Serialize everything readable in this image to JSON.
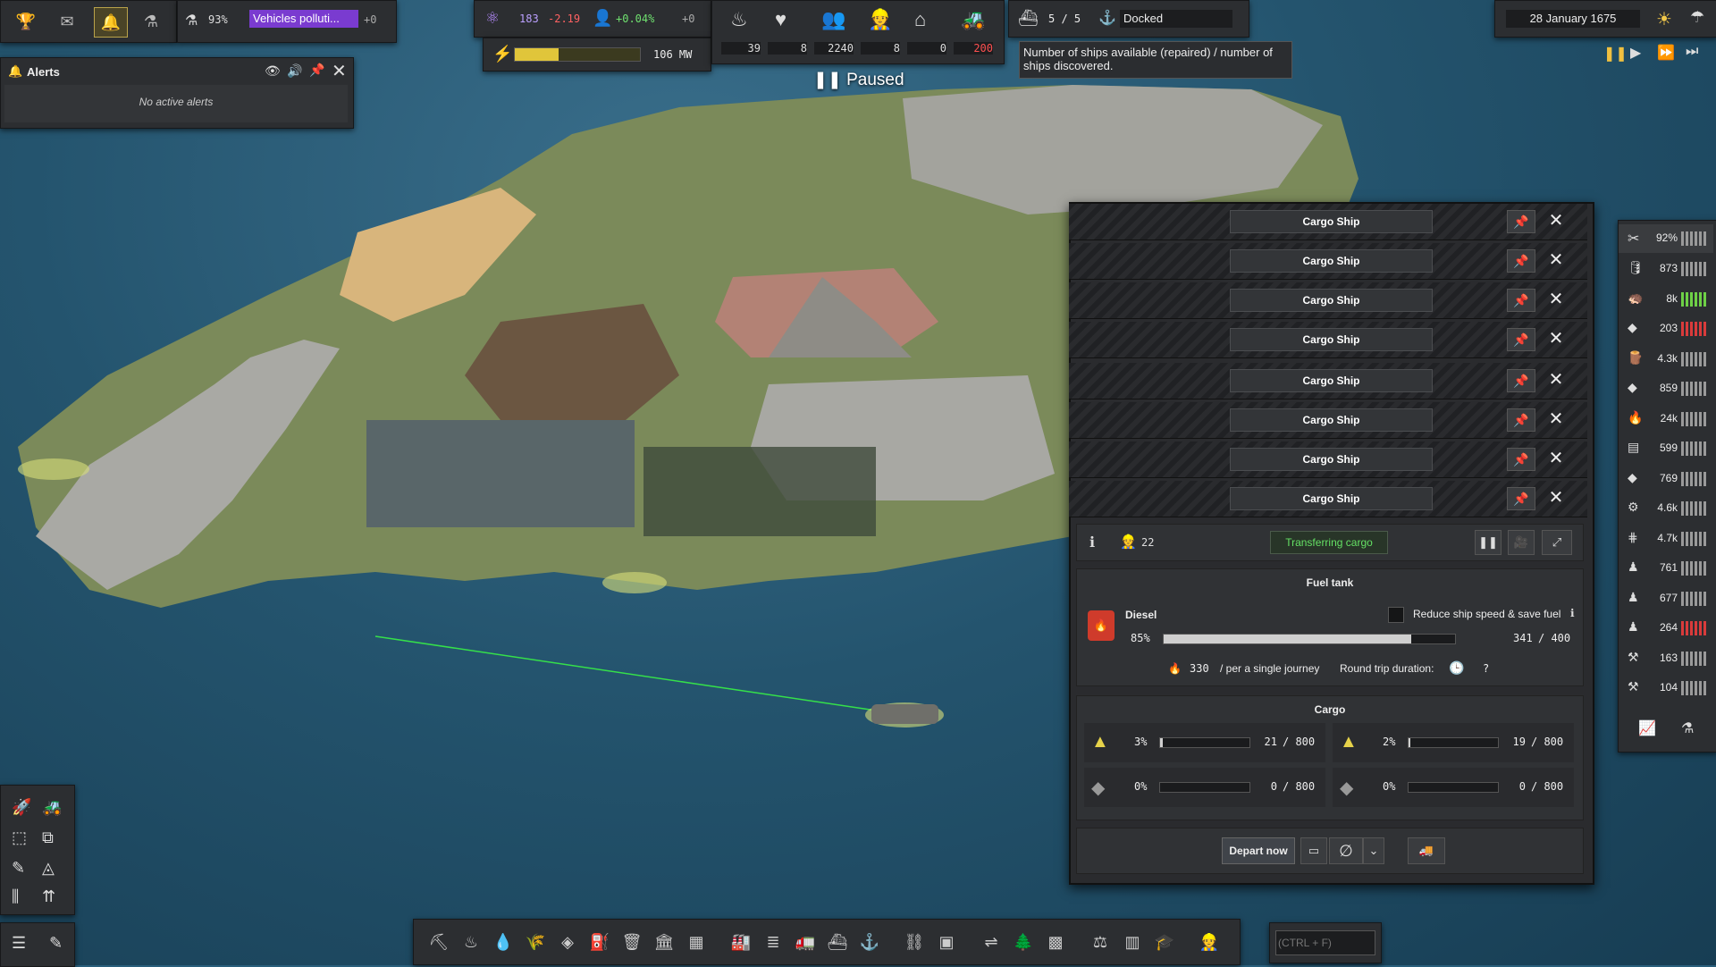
{
  "top_left": {
    "research_pct": "93%",
    "research_title": "Vehicles polluti...",
    "research_extra": "+0"
  },
  "alerts": {
    "title": "Alerts",
    "empty_text": "No active alerts"
  },
  "unity": {
    "value": "183",
    "delta": "-2.19",
    "pop_delta": "+0.04%",
    "plus": "+0"
  },
  "power": {
    "value": "106 MW",
    "fill_pct": 35
  },
  "stats": {
    "food": "39",
    "health": "8",
    "population": "2240",
    "workers": "8",
    "housing": "0",
    "vehicles": "200"
  },
  "ships_status": {
    "value": "5 / 5",
    "state": "Docked",
    "tooltip": "Number of ships available (repaired) / number of ships discovered."
  },
  "date": "28 January 1675",
  "paused_label": "Paused",
  "ship_window": {
    "rows": [
      "Cargo Ship",
      "Cargo Ship",
      "Cargo Ship",
      "Cargo Ship",
      "Cargo Ship",
      "Cargo Ship",
      "Cargo Ship",
      "Cargo Ship"
    ],
    "crew": "22",
    "status": "Transferring cargo",
    "fuel_section": "Fuel tank",
    "fuel_name": "Diesel",
    "fuel_pct": "85%",
    "fuel_fill": 85,
    "fuel_current": "341",
    "fuel_capacity": "/ 400",
    "reduce_speed_label": "Reduce ship speed & save fuel",
    "journey_fuel": "330",
    "journey_label": "/ per a single journey",
    "round_trip_label": "Round trip duration:",
    "round_trip_value": "?",
    "cargo_section": "Cargo",
    "cargo": [
      {
        "pct": "3%",
        "fill": 3,
        "amount": "21",
        "cap": "/ 800"
      },
      {
        "pct": "2%",
        "fill": 2,
        "amount": "19",
        "cap": "/ 800"
      },
      {
        "pct": "0%",
        "fill": 0,
        "amount": "0",
        "cap": "/ 800"
      },
      {
        "pct": "0%",
        "fill": 0,
        "amount": "0",
        "cap": "/ 800"
      }
    ],
    "depart_label": "Depart now"
  },
  "resources": {
    "maintenance": "92%",
    "items": [
      "873",
      "8k",
      "203",
      "4.3k",
      "859",
      "24k",
      "599",
      "769",
      "4.6k",
      "4.7k",
      "761",
      "677",
      "264",
      "163",
      "104"
    ]
  },
  "search_placeholder": "(CTRL + F)"
}
